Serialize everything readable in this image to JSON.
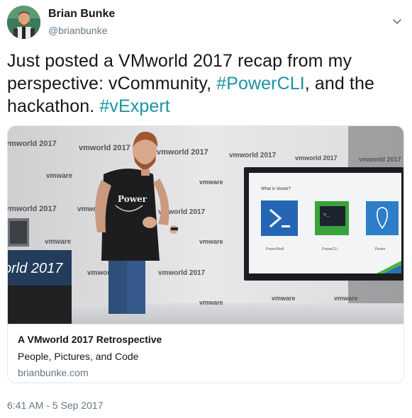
{
  "user": {
    "name": "Brian Bunke",
    "handle": "@brianbunke"
  },
  "tweet": {
    "text_before": "Just posted a VMworld 2017 recap from my perspective: vCommunity, ",
    "hashtag1": "#PowerCLI",
    "text_middle": ", and the hackathon. ",
    "hashtag2": "#vExpert",
    "hashtag_color": "#1b95a0"
  },
  "card": {
    "title": "A VMworld 2017 Retrospective",
    "description": "People, Pictures, and Code",
    "domain": "brianbunke.com",
    "backdrop_logos": [
      "vmworld 2017",
      "vmware"
    ],
    "screen": {
      "heading": "What is Vester?",
      "tiles": [
        "PowerShell",
        "PowerCLI",
        "Pester"
      ]
    },
    "shirt_text": "Power",
    "podium_text": "orld 2017"
  },
  "timestamp": "6:41 AM - 5 Sep 2017",
  "icons": {
    "menu": "chevron-down-icon"
  }
}
